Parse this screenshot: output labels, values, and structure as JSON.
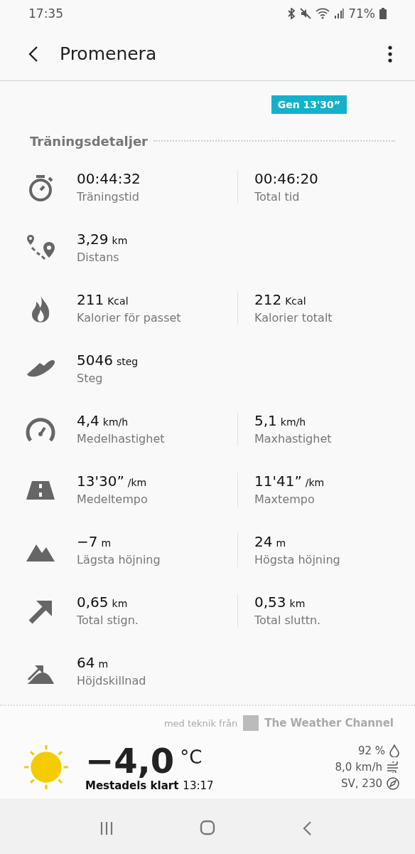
{
  "status_bar": {
    "time": "17:35",
    "battery": "71%"
  },
  "app_bar": {
    "title": "Promenera"
  },
  "pace_marker": "Gen 13'30”",
  "section_title": "Träningsdetaljer",
  "stats": [
    {
      "kind": "stopwatch",
      "items": [
        {
          "value": "00:44:32",
          "label": "Träningstid"
        },
        {
          "value": "00:46:20",
          "label": "Total tid"
        }
      ]
    },
    {
      "kind": "route",
      "items": [
        {
          "value": "3,29",
          "unit": "km",
          "label": "Distans"
        }
      ]
    },
    {
      "kind": "flame",
      "items": [
        {
          "value": "211",
          "unit": "Kcal",
          "label": "Kalorier för passet"
        },
        {
          "value": "212",
          "unit": "Kcal",
          "label": "Kalorier totalt"
        }
      ]
    },
    {
      "kind": "shoe",
      "items": [
        {
          "value": "5046",
          "unit": "steg",
          "label": "Steg"
        }
      ]
    },
    {
      "kind": "speedometer",
      "items": [
        {
          "value": "4,4",
          "unit": "km/h",
          "label": "Medelhastighet"
        },
        {
          "value": "5,1",
          "unit": "km/h",
          "label": "Maxhastighet"
        }
      ]
    },
    {
      "kind": "road",
      "items": [
        {
          "value": "13'30”",
          "unit": "/km",
          "label": "Medeltempo"
        },
        {
          "value": "11'41”",
          "unit": "/km",
          "label": "Maxtempo"
        }
      ]
    },
    {
      "kind": "mountain",
      "items": [
        {
          "value": "−7",
          "unit": "m",
          "label": "Lägsta höjning"
        },
        {
          "value": "24",
          "unit": "m",
          "label": "Högsta höjning"
        }
      ]
    },
    {
      "kind": "arrow",
      "items": [
        {
          "value": "0,65",
          "unit": "km",
          "label": "Total stign."
        },
        {
          "value": "0,53",
          "unit": "km",
          "label": "Total sluttn."
        }
      ]
    },
    {
      "kind": "elevation",
      "items": [
        {
          "value": "64",
          "unit": "m",
          "label": "Höjdskillnad"
        }
      ]
    }
  ],
  "weather": {
    "attribution": "med teknik från",
    "provider": "The Weather Channel",
    "temperature": "−4,0",
    "temperature_unit": "°C",
    "condition": "Mestadels klart",
    "time": "13:17",
    "humidity": "92 %",
    "wind_speed": "8,0 km/h",
    "wind_direction": "SV, 230"
  }
}
